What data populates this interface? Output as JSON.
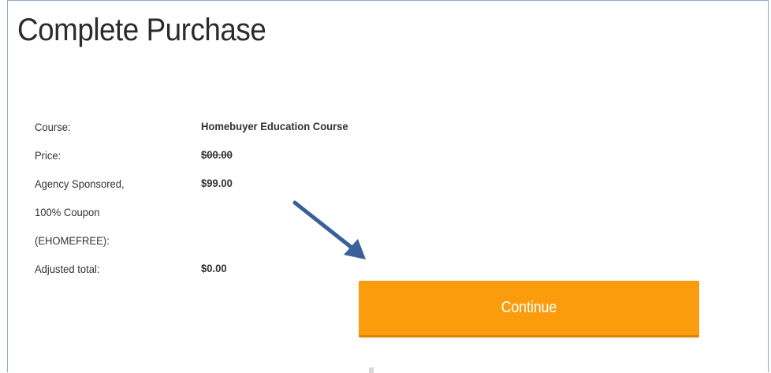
{
  "page": {
    "title": "Complete Purchase"
  },
  "summary": {
    "course_label": "Course:",
    "course_value": "Homebuyer Education Course",
    "price_label": "Price:",
    "price_value": "$00.00",
    "coupon_label_line1": "Agency Sponsored,",
    "coupon_label_line2": "100% Coupon",
    "coupon_label_line3": "(EHOMEFREE):",
    "coupon_value": "$99.00",
    "adjusted_label": "Adjusted total:",
    "adjusted_value": "$0.00"
  },
  "actions": {
    "continue_label": "Continue"
  },
  "colors": {
    "continue_button": "#fa9c0c",
    "arrow": "#3a5f9a",
    "frame_border": "#8fa8cc"
  },
  "icons": {
    "pointer_arrow": "arrow-down-right-icon"
  }
}
